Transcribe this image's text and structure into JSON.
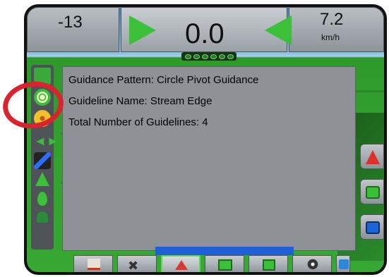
{
  "topbar": {
    "left_value": "-13",
    "center_value": "0.0",
    "right_value": "7.2",
    "right_unit": "km/h"
  },
  "info_panel": {
    "line_1": "Guidance Pattern: Circle Pivot Guidance",
    "line_2": "Guideline Name: Stream Edge",
    "line_3": "Total Number of Guidelines: 4"
  },
  "left_toolbar": {
    "icons": [
      "straight-ab-icon",
      "circle-pivot-icon",
      "guideline-info-icon",
      "steering-icon",
      "tools-icon",
      "marker-icon",
      "drop-icon",
      "user-icon"
    ]
  },
  "right_toolbar": {
    "icons": [
      "vehicle-view-icon",
      "field-view-icon",
      "bound-view-icon"
    ]
  },
  "bottom_toolbar": {
    "buttons": [
      "home-icon",
      "tools-icon",
      "guidance-icon",
      "field-flag-icon",
      "section-icon",
      "gauge-icon",
      "data-icon"
    ],
    "active": "guidance-icon"
  },
  "colors": {
    "accent_green": "#3cc03a",
    "callout_red": "#d9232e",
    "panel_gray": "#8e9296"
  }
}
